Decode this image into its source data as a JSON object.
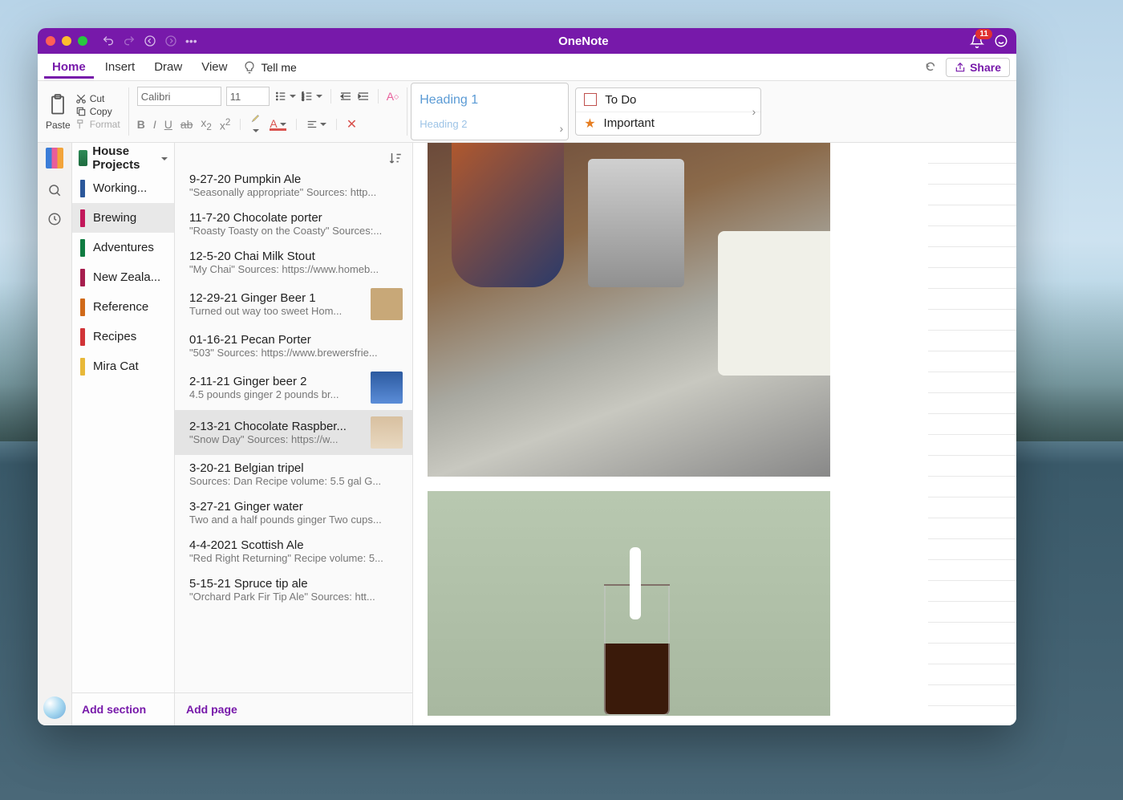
{
  "app": {
    "title": "OneNote",
    "notif_count": "11"
  },
  "menu": {
    "tabs": [
      "Home",
      "Insert",
      "Draw",
      "View"
    ],
    "active": "Home",
    "tellme": "Tell me",
    "share": "Share"
  },
  "ribbon": {
    "paste": "Paste",
    "cut": "Cut",
    "copy": "Copy",
    "format": "Format",
    "font": "Calibri",
    "size": "11",
    "heading1": "Heading 1",
    "heading2": "Heading 2",
    "tags": {
      "todo": "To Do",
      "important": "Important"
    }
  },
  "notebook": {
    "name": "House Projects"
  },
  "sections": [
    {
      "label": "Working...",
      "color": "#2b579a"
    },
    {
      "label": "Brewing",
      "color": "#c2185b",
      "active": true
    },
    {
      "label": "Adventures",
      "color": "#107c41"
    },
    {
      "label": "New Zeala...",
      "color": "#a61e4e"
    },
    {
      "label": "Reference",
      "color": "#d06a1a"
    },
    {
      "label": "Recipes",
      "color": "#d13438"
    },
    {
      "label": "Mira Cat",
      "color": "#e8b839"
    }
  ],
  "add_section": "Add section",
  "add_page": "Add page",
  "pages": [
    {
      "title": "9-27-20 Pumpkin Ale",
      "sub": "\"Seasonally appropriate\"  Sources: http...",
      "cutoff": true
    },
    {
      "title": "11-7-20 Chocolate porter",
      "sub": "\"Roasty Toasty on the Coasty\"  Sources:..."
    },
    {
      "title": "12-5-20 Chai Milk Stout",
      "sub": "\"My Chai\"  Sources: https://www.homeb..."
    },
    {
      "title": "12-29-21 Ginger Beer 1",
      "sub": "Turned out way too sweet  Hom...",
      "thumb": "a"
    },
    {
      "title": "01-16-21 Pecan Porter",
      "sub": "\"503\"  Sources: https://www.brewersfrie..."
    },
    {
      "title": "2-11-21 Ginger beer 2",
      "sub": "4.5 pounds ginger  2 pounds br...",
      "thumb": "b"
    },
    {
      "title": "2-13-21 Chocolate Raspber...",
      "sub": "\"Snow Day\"  Sources: https://w...",
      "thumb": "c",
      "selected": true
    },
    {
      "title": "3-20-21 Belgian tripel",
      "sub": "Sources: Dan  Recipe volume: 5.5 gal  G..."
    },
    {
      "title": "3-27-21 Ginger water",
      "sub": "Two and a half pounds ginger  Two cups..."
    },
    {
      "title": "4-4-2021 Scottish Ale",
      "sub": "\"Red Right Returning\"  Recipe volume: 5..."
    },
    {
      "title": "5-15-21 Spruce tip ale",
      "sub": "\"Orchard Park Fir Tip Ale\"  Sources:  htt..."
    }
  ]
}
